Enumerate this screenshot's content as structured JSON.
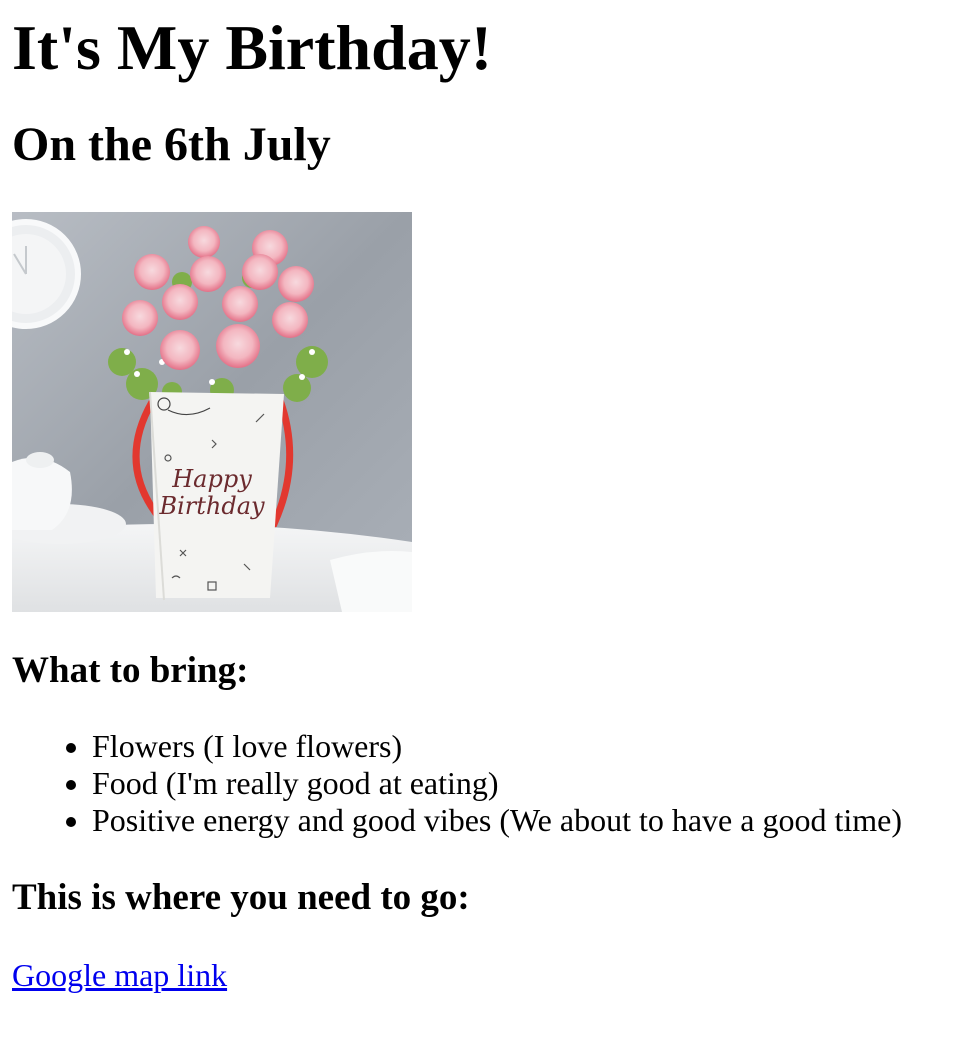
{
  "page": {
    "title": "It's My Birthday!",
    "subtitle": "On the 6th July"
  },
  "image": {
    "subject": "pink roses in a white gift box with red ribbon handle",
    "box_text_line1": "Happy",
    "box_text_line2": "Birthday"
  },
  "bring": {
    "heading": "What to bring:",
    "items": [
      "Flowers (I love flowers)",
      "Food (I'm really good at eating)",
      "Positive energy and good vibes (We about to have a good time)"
    ]
  },
  "location": {
    "heading": "This is where you need to go:",
    "link_text": "Google map link"
  },
  "colors": {
    "link": "#0000ee",
    "ribbon": "#e2382f",
    "rose": "#e8748a"
  }
}
